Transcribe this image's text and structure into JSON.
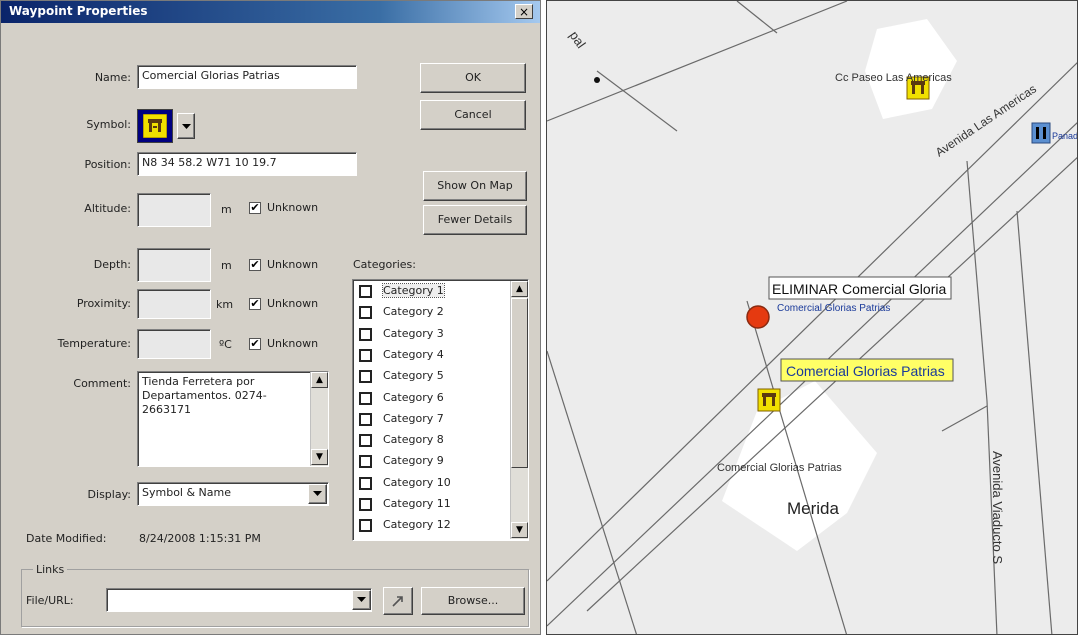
{
  "dialog": {
    "title": "Waypoint Properties",
    "close_glyph": "×",
    "labels": {
      "name": "Name:",
      "symbol": "Symbol:",
      "position": "Position:",
      "altitude": "Altitude:",
      "depth": "Depth:",
      "proximity": "Proximity:",
      "temperature": "Temperature:",
      "comment": "Comment:",
      "display": "Display:",
      "date_modified": "Date Modified:",
      "categories": "Categories:"
    },
    "values": {
      "name": "Comercial Glorias Patrias",
      "position": "N8 34 58.2 W71 10 19.7",
      "altitude": "",
      "depth": "",
      "proximity": "",
      "temperature": "",
      "comment": "Tienda Ferretera por Departamentos. 0274-2663171",
      "display": "Symbol & Name",
      "date_modified": "8/24/2008 1:15:31 PM"
    },
    "units": {
      "altitude": "m",
      "depth": "m",
      "proximity": "km",
      "temperature": "ºC"
    },
    "unknown_label": "Unknown",
    "unknown_checked": {
      "altitude": true,
      "depth": true,
      "proximity": true,
      "temperature": true
    },
    "buttons": {
      "ok": "OK",
      "cancel": "Cancel",
      "show_on_map": "Show On Map",
      "fewer_details": "Fewer Details",
      "browse": "Browse..."
    },
    "categories": [
      "Category 1",
      "Category 2",
      "Category 3",
      "Category 4",
      "Category 5",
      "Category 6",
      "Category 7",
      "Category 8",
      "Category 9",
      "Category 10",
      "Category 11",
      "Category 12"
    ],
    "links": {
      "group_label": "Links",
      "file_url_label": "File/URL:",
      "file_url_value": ""
    },
    "icons": {
      "symbol": "restaurant-icon",
      "dropdown": "chevron-down-icon",
      "link": "link-arrow-icon"
    }
  },
  "map": {
    "labels": {
      "road_top_left": "pal",
      "cc_paseo": "Cc Paseo Las Americas",
      "avenida_americas": "Avenida Las Americas",
      "panaderia": "Panadera C",
      "eliminar_tag": "ELIMINAR Comercial Gloria",
      "eliminar_sub": "Comercial Glorias Patrias",
      "selected_tag": "Comercial Glorias Patrias",
      "area_label": "Comercial Glorias Patrias",
      "city": "Merida",
      "viaducto": "Avenida Viaducto S"
    },
    "colors": {
      "selected_highlight": "#ffff66",
      "deleted_marker": "#e53a10",
      "area_fill": "#ffffff",
      "road": "#6a6a6a"
    }
  }
}
